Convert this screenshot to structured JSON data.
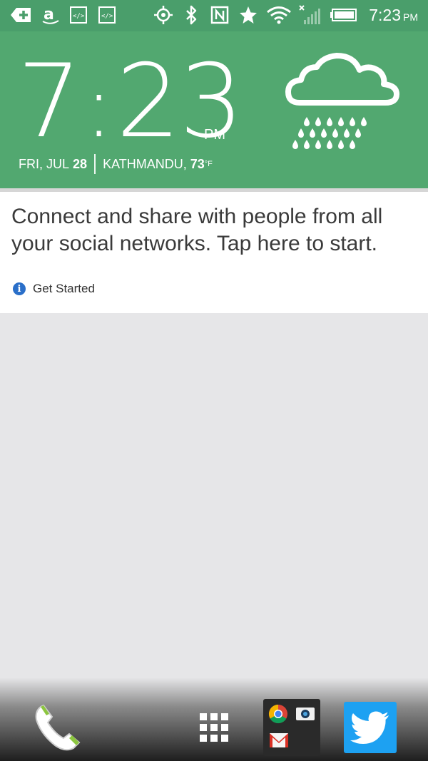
{
  "status_bar": {
    "time": "7:23",
    "ampm": "PM",
    "icons": [
      "plus-icon",
      "amazon-icon",
      "code-icon",
      "code-icon",
      "location-icon",
      "bluetooth-icon",
      "nfc-icon",
      "star-icon",
      "wifi-icon",
      "signal-icon",
      "battery-icon"
    ]
  },
  "clock_widget": {
    "hour": "7",
    "minutes": "23",
    "ampm": "PM",
    "date_prefix": "FRI, JUL",
    "date_day": "28",
    "location": "KATHMANDU,",
    "temperature": "73",
    "temp_unit": "°F",
    "weather_icon": "rain-cloud-icon"
  },
  "social_card": {
    "message": "Connect and share with people from all your social networks. Tap here to start.",
    "link_label": "Get Started"
  },
  "dock": {
    "items": [
      "phone",
      "all-apps",
      "google-folder",
      "twitter"
    ]
  },
  "colors": {
    "status_bar": "#4a9e6b",
    "widget": "#52a870",
    "card": "#ffffff",
    "background": "#e6e6e8",
    "twitter": "#1da1f2"
  }
}
